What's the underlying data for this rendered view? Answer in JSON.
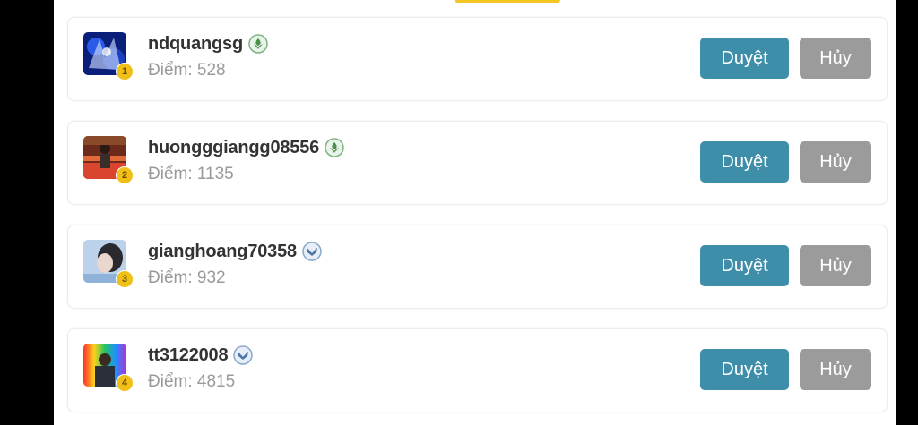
{
  "colors": {
    "accent": "#3f8ea9",
    "cancel": "#9b9b9b",
    "rank_badge": "#f0c018"
  },
  "requests": [
    {
      "rank": "1",
      "username": "ndquangsg",
      "score": "Điểm: 528",
      "badge_icon": "green-leaf-rank-icon",
      "approve_label": "Duyệt",
      "cancel_label": "Hủy"
    },
    {
      "rank": "2",
      "username": "huongggiangg08556",
      "score": "Điểm: 1135",
      "badge_icon": "green-leaf-rank-icon",
      "approve_label": "Duyệt",
      "cancel_label": "Hủy"
    },
    {
      "rank": "3",
      "username": "gianghoang70358",
      "score": "Điểm: 932",
      "badge_icon": "blue-wing-rank-icon",
      "approve_label": "Duyệt",
      "cancel_label": "Hủy"
    },
    {
      "rank": "4",
      "username": "tt3122008",
      "score": "Điểm: 4815",
      "badge_icon": "blue-wing-rank-icon",
      "approve_label": "Duyệt",
      "cancel_label": "Hủy"
    }
  ]
}
